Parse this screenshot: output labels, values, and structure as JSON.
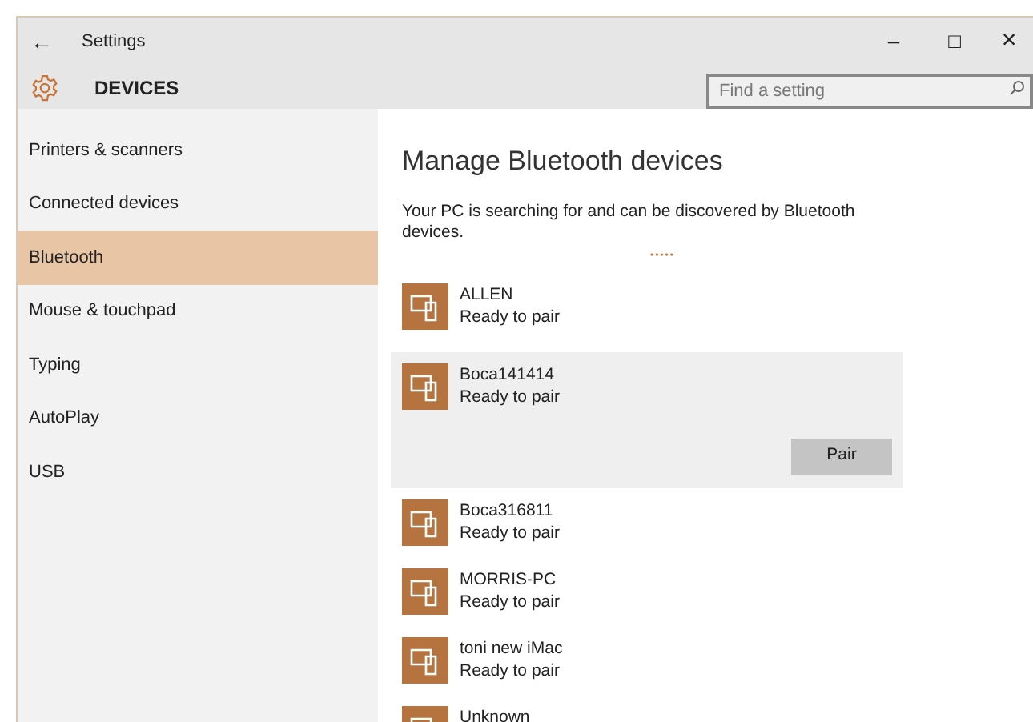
{
  "window": {
    "back": "←",
    "title": "Settings",
    "minimize": "–",
    "maximize": "□",
    "close": "×"
  },
  "header": {
    "title": "DEVICES",
    "search": {
      "placeholder": "Find a setting"
    }
  },
  "sidebar": {
    "items": [
      {
        "label": "Printers & scanners",
        "selected": false
      },
      {
        "label": "Connected devices",
        "selected": false
      },
      {
        "label": "Bluetooth",
        "selected": true
      },
      {
        "label": "Mouse & touchpad",
        "selected": false
      },
      {
        "label": "Typing",
        "selected": false
      },
      {
        "label": "AutoPlay",
        "selected": false
      },
      {
        "label": "USB",
        "selected": false
      }
    ]
  },
  "content": {
    "title": "Manage Bluetooth devices",
    "description": "Your PC is searching for and can be discovered by Bluetooth devices.",
    "progress": "•••••",
    "devices": [
      {
        "name": "ALLEN",
        "status": "Ready to pair",
        "selected": false
      },
      {
        "name": "Boca141414",
        "status": "Ready to pair",
        "selected": true,
        "action": "Pair"
      },
      {
        "name": "Boca316811",
        "status": "Ready to pair",
        "selected": false
      },
      {
        "name": "MORRIS-PC",
        "status": "Ready to pair",
        "selected": false
      },
      {
        "name": "toni new iMac",
        "status": "Ready to pair",
        "selected": false
      },
      {
        "name": "Unknown",
        "selected": false
      }
    ]
  }
}
